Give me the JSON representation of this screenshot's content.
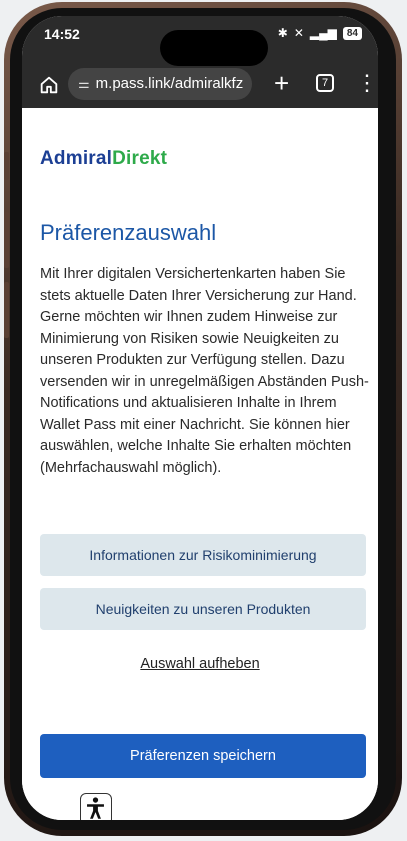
{
  "status_bar": {
    "time": "14:52",
    "battery": "84",
    "icons": [
      "bluetooth-icon",
      "mute-icon",
      "signal-5g-icon",
      "battery-icon"
    ]
  },
  "browser": {
    "url": "m.pass.link/admiralkfz",
    "tab_count": "7",
    "icons": [
      "home-icon",
      "tune-icon",
      "plus-icon",
      "tabs-icon",
      "menu-icon"
    ]
  },
  "page": {
    "logo": {
      "part1": "Admiral",
      "part2": "Direkt"
    },
    "heading": "Präferenzauswahl",
    "paragraph": "Mit Ihrer digitalen Versichertenkarten haben Sie stets aktuelle Daten Ihrer Versicherung zur Hand. Gerne möchten wir Ihnen zudem Hinweise zur Minimierung von Risiken sowie Neuigkeiten zu unseren Produkten zur Verfügung stellen. Dazu versenden wir in unregelmäßigen Abständen Push-Notifications und aktualisieren Inhalte in Ihrem Wallet Pass mit einer Nachricht. Sie können hier auswählen, welche Inhalte Sie erhalten möchten (Mehrfachauswahl möglich).",
    "options": [
      {
        "label": "Informationen zur Risikominimierung"
      },
      {
        "label": "Neuigkeiten zu unseren Produkten"
      }
    ],
    "clear_link": "Auswahl aufheben",
    "save_button": "Präferenzen speichern",
    "accessibility_icon": "accessibility-icon"
  },
  "colors": {
    "brand_blue": "#1c3f94",
    "brand_green": "#2eaa4a",
    "heading_blue": "#1c57a6",
    "primary_button": "#1e5fbf",
    "option_button_bg": "#dde7ec"
  }
}
